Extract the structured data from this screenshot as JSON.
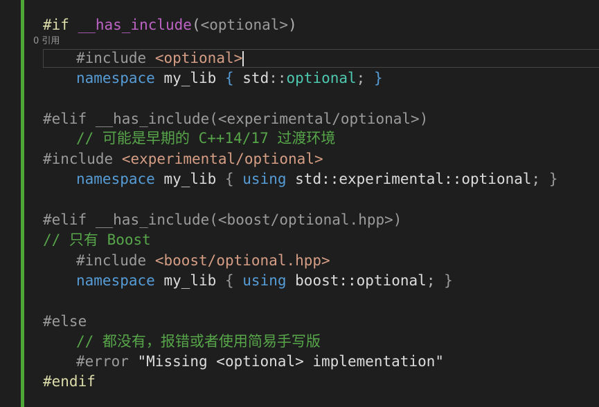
{
  "editor": {
    "codelens": "0 引用",
    "lines": {
      "l1": {
        "directive": "#if",
        "sp": " ",
        "macro": "__has_include",
        "open": "(",
        "header": "<optional>",
        "close": ")"
      },
      "l2": {
        "directive": "#include",
        "sp": " ",
        "header": "<optional>"
      },
      "l3": {
        "kw": "namespace",
        "sp1": " ",
        "name": "my_lib",
        "sp2": " ",
        "lbrace": "{",
        "sp3": " ",
        "ns": "std",
        "sep": "::",
        "type": "optional",
        "semi": ";",
        "sp4": " ",
        "rbrace": "}"
      },
      "l5": {
        "directive": "#elif",
        "sp": " ",
        "macro": "__has_include",
        "open": "(",
        "header": "<experimental/optional>",
        "close": ")"
      },
      "l6": {
        "comment": "// 可能是早期的 C++14/17 过渡环境"
      },
      "l7": {
        "directive": "#include",
        "sp": " ",
        "header": "<experimental/optional>"
      },
      "l8": {
        "kw": "namespace",
        "sp1": " ",
        "name": "my_lib",
        "sp2": " ",
        "lbrace": "{",
        "sp3": " ",
        "using": "using",
        "sp4": " ",
        "qualified": "std::experimental::optional",
        "semi": ";",
        "sp5": " ",
        "rbrace": "}"
      },
      "l10": {
        "directive": "#elif",
        "sp": " ",
        "macro": "__has_include",
        "open": "(",
        "header": "<boost/optional.hpp>",
        "close": ")"
      },
      "l11": {
        "comment": "// 只有 Boost"
      },
      "l12": {
        "directive": "#include",
        "sp": " ",
        "header": "<boost/optional.hpp>"
      },
      "l13": {
        "kw": "namespace",
        "sp1": " ",
        "name": "my_lib",
        "sp2": " ",
        "lbrace": "{",
        "sp3": " ",
        "using": "using",
        "sp4": " ",
        "qualified": "boost::optional",
        "semi": ";",
        "sp5": " ",
        "rbrace": "}"
      },
      "l15": {
        "directive": "#else"
      },
      "l16": {
        "comment": "// 都没有，报错或者使用简易手写版"
      },
      "l17": {
        "directive": "#error",
        "sp": " ",
        "message": "\"Missing <optional> implementation\""
      },
      "l18": {
        "directive": "#endif"
      }
    }
  },
  "colors": {
    "background": "#1e1e1e",
    "change_bar": "#4ca736",
    "preprocessor_active": "#b8d7a3",
    "preprocessor_inactive": "#9b9b9b",
    "macro": "#bd63c5",
    "string": "#d69d85",
    "keyword": "#569cd6",
    "type": "#4ec9b0",
    "comment": "#57a64a"
  }
}
